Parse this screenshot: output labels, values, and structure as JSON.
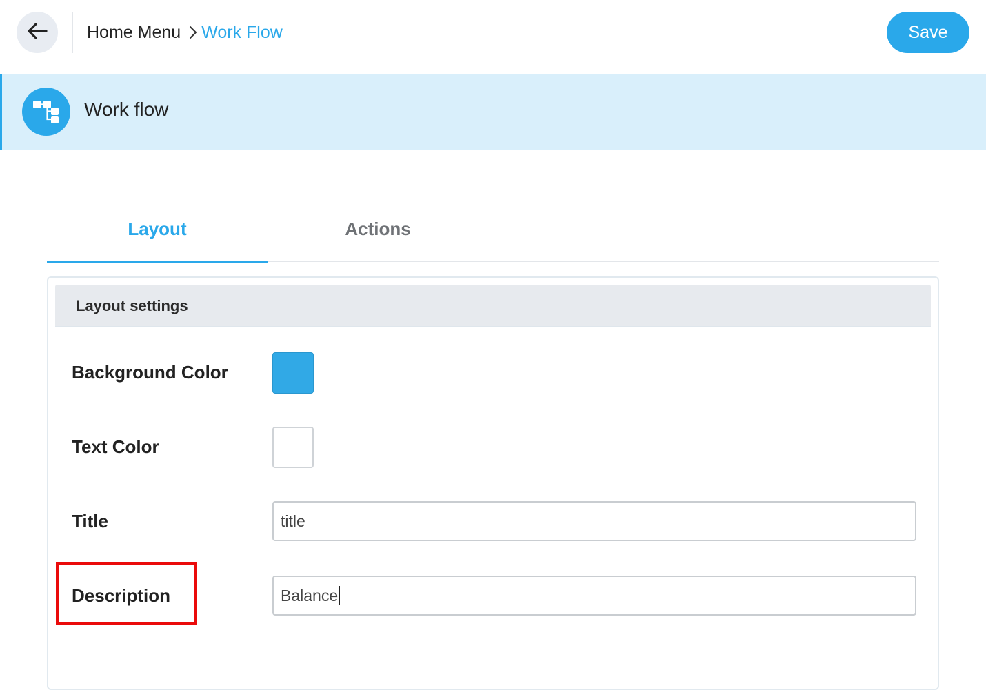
{
  "topbar": {
    "back_icon": "arrow-left-icon",
    "breadcrumb": {
      "home": "Home Menu",
      "separator_icon": "chevron-right-icon",
      "current": "Work Flow"
    },
    "save_label": "Save"
  },
  "header": {
    "icon": "workflow-icon",
    "title": "Work flow"
  },
  "tabs": [
    {
      "label": "Layout",
      "active": true
    },
    {
      "label": "Actions",
      "active": false
    }
  ],
  "layout_settings": {
    "heading": "Layout settings",
    "background_color": {
      "label": "Background Color",
      "value": "#31a9e6"
    },
    "text_color": {
      "label": "Text Color",
      "value": "#ffffff"
    },
    "title": {
      "label": "Title",
      "value": "title"
    },
    "description": {
      "label": "Description",
      "value": "Balance"
    }
  },
  "colors": {
    "accent": "#2aa8ea",
    "header_band": "#d9effb",
    "highlight": "#ea0b0b"
  }
}
